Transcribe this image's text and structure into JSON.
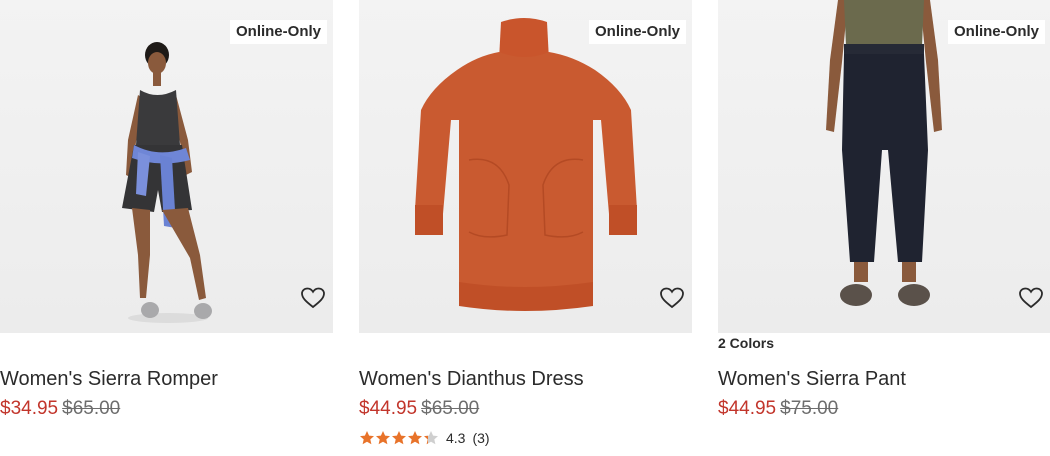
{
  "products": [
    {
      "badge": "Online-Only",
      "name": "Women's Sierra Romper",
      "sale_price": "$34.95",
      "original_price": "$65.00",
      "image": "woman-wearing-gray-romper-photo"
    },
    {
      "badge": "Online-Only",
      "name": "Women's Dianthus Dress",
      "sale_price": "$44.95",
      "original_price": "$65.00",
      "rating": "4.3",
      "rating_value": 4.3,
      "review_count": "(3)",
      "image": "orange-sweater-dress-photo"
    },
    {
      "badge": "Online-Only",
      "colors": "2 Colors",
      "name": "Women's Sierra Pant",
      "sale_price": "$44.95",
      "original_price": "$75.00",
      "image": "woman-wearing-black-pants-photo"
    }
  ],
  "colors": {
    "sale": "#c2352b",
    "star": "#e8732a",
    "star_empty": "#cfcfcf"
  },
  "icons": {
    "wishlist": "heart-outline-icon",
    "rating": "star-icon"
  }
}
